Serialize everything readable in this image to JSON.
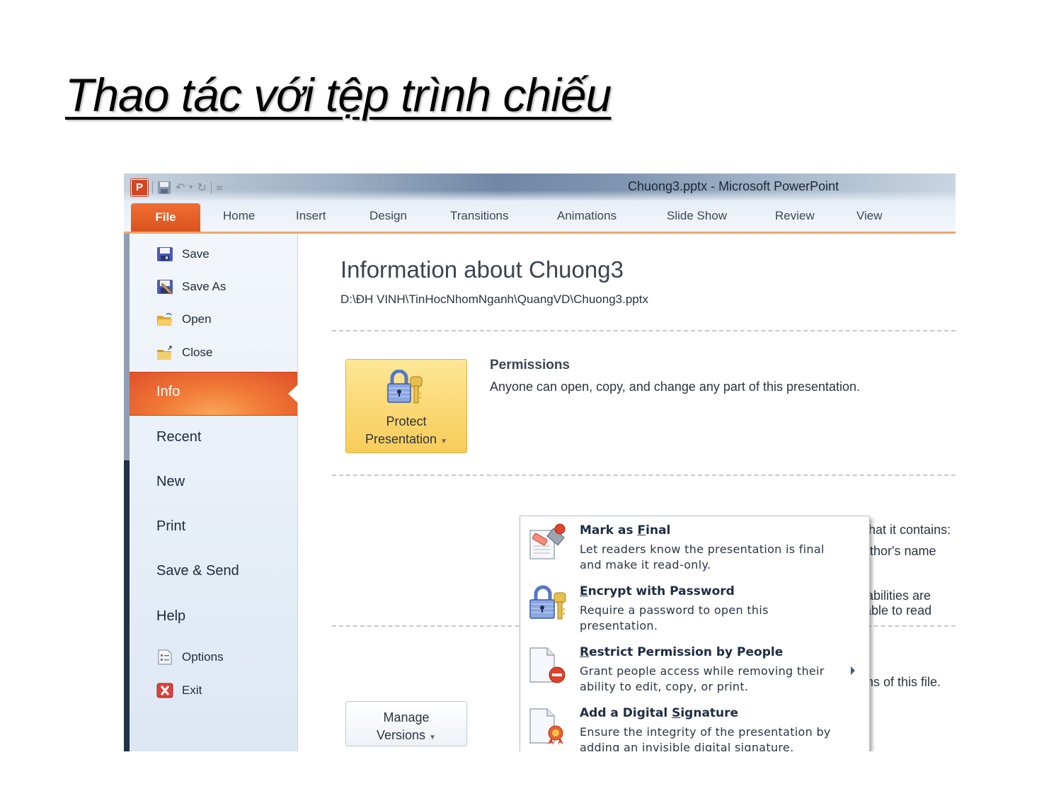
{
  "slide": {
    "title": "Thao tác với tệp trình chiếu"
  },
  "window": {
    "title": "Chuong3.pptx  -  Microsoft PowerPoint",
    "app_icon_letter": "P",
    "quick_access": [
      "save-icon",
      "undo-icon",
      "redo-icon",
      "customize-icon"
    ]
  },
  "ribbon": {
    "tabs": [
      {
        "label": "File",
        "active": true
      },
      {
        "label": "Home"
      },
      {
        "label": "Insert"
      },
      {
        "label": "Design"
      },
      {
        "label": "Transitions"
      },
      {
        "label": "Animations"
      },
      {
        "label": "Slide Show"
      },
      {
        "label": "Review"
      },
      {
        "label": "View"
      }
    ]
  },
  "backstage": {
    "commands": [
      {
        "label": "Save",
        "icon": "save-icon"
      },
      {
        "label": "Save As",
        "icon": "save-as-icon"
      },
      {
        "label": "Open",
        "icon": "open-folder-icon"
      },
      {
        "label": "Close",
        "icon": "close-folder-icon"
      }
    ],
    "tabs": [
      {
        "label": "Info",
        "active": true
      },
      {
        "label": "Recent"
      },
      {
        "label": "New"
      },
      {
        "label": "Print"
      },
      {
        "label": "Save & Send"
      },
      {
        "label": "Help"
      }
    ],
    "bottom_commands": [
      {
        "label": "Options",
        "icon": "options-icon"
      },
      {
        "label": "Exit",
        "icon": "exit-icon"
      }
    ]
  },
  "info": {
    "title": "Information about Chuong3",
    "path": "D:\\ĐH VINH\\TinHocNhomNganh\\QuangVD\\Chuong3.pptx",
    "protect_button": {
      "line1": "Protect",
      "line2": "Presentation"
    },
    "permissions_heading": "Permissions",
    "permissions_desc": "Anyone can open, copy, and change any part of this presentation.",
    "partial_texts": {
      "contains": "re that it contains:",
      "author": "author's name",
      "disabilities": "disabilities are unable to read",
      "versions": "sions of this file."
    },
    "manage_button": {
      "line1": "Manage",
      "line2": "Versions"
    }
  },
  "protect_menu": {
    "items": [
      {
        "title_pre": "Mark as ",
        "title_acc": "F",
        "title_post": "inal",
        "desc": "Let readers know the presentation is final and make it read-only.",
        "icon": "mark-final-icon",
        "has_submenu": false
      },
      {
        "title_pre": "",
        "title_acc": "E",
        "title_post": "ncrypt with Password",
        "desc": "Require a password to open this presentation.",
        "icon": "lock-key-icon",
        "has_submenu": false
      },
      {
        "title_pre": "",
        "title_acc": "R",
        "title_post": "estrict Permission by People",
        "desc": "Grant people access while removing their ability to edit, copy, or print.",
        "icon": "restrict-permission-icon",
        "has_submenu": true
      },
      {
        "title_pre": "Add a Digital ",
        "title_acc": "S",
        "title_post": "ignature",
        "desc": "Ensure the integrity of the presentation by adding an invisible digital signature.",
        "icon": "digital-signature-icon",
        "has_submenu": false
      }
    ]
  },
  "colors": {
    "file_tab": "#d9541e",
    "info_active": "#f07a36",
    "protect_button": "#fbd670",
    "nav_background": "#dde7f3"
  }
}
